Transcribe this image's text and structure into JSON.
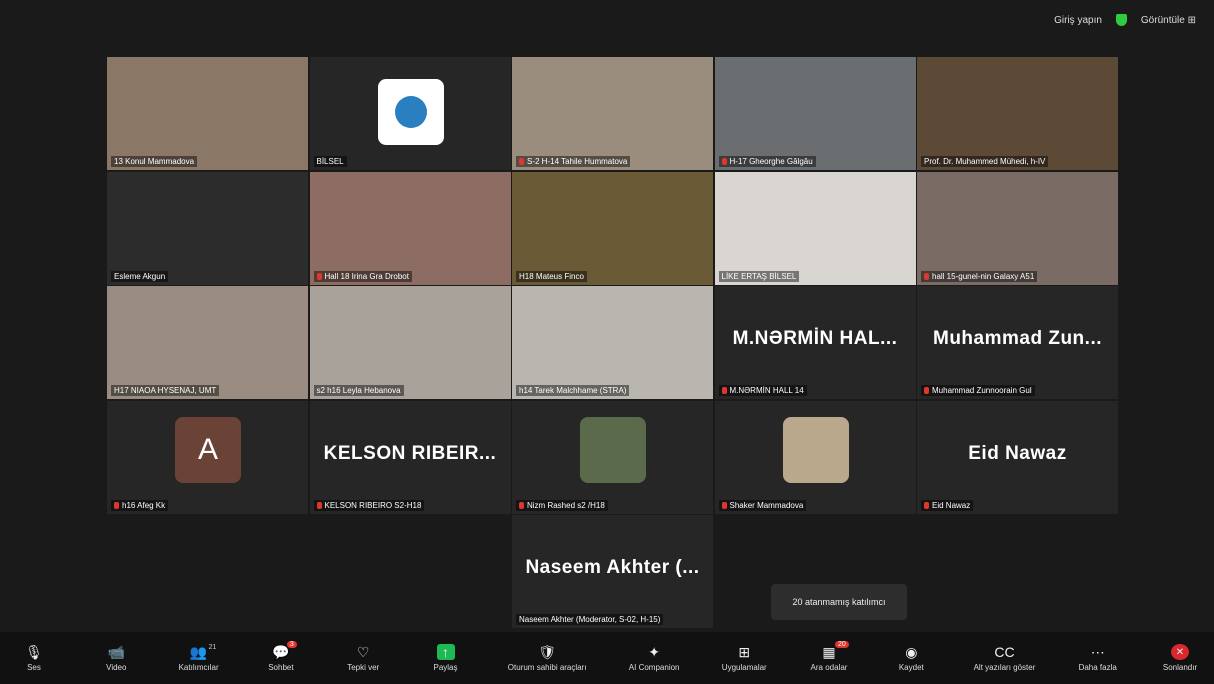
{
  "topbar": {
    "login": "Giriş yapın",
    "view": "Görüntüle"
  },
  "participants": [
    {
      "label": "13 Konul Mammadova",
      "muted": false,
      "bg": "#8a7766"
    },
    {
      "label": "BİLSEL",
      "muted": false,
      "bg": "#262626",
      "logo": true
    },
    {
      "label": "S-2 H-14 Tahile Hummatova",
      "muted": true,
      "bg": "#9a8d7d"
    },
    {
      "label": "H-17 Gheorghe Gâlgâu",
      "muted": true,
      "bg": "#6a6e70"
    },
    {
      "label": "Prof. Dr. Muhammed Mühedi, h-IV",
      "muted": false,
      "bg": "#5c4a36"
    },
    {
      "label": "Esleme Akgun",
      "muted": false,
      "bg": "#2c2c2c"
    },
    {
      "label": "Hall 18 Irina Gra Drobot",
      "muted": true,
      "bg": "#8c6c63"
    },
    {
      "label": "H18 Mateus Finco",
      "muted": false,
      "bg": "#6a5a35"
    },
    {
      "label": "LİKE ERTAŞ BİLSEL",
      "muted": false,
      "bg": "#d9d6d2",
      "active": true
    },
    {
      "label": "hall 15-gunel-nin Galaxy A51",
      "muted": true,
      "bg": "#7a6c64"
    },
    {
      "label": "H17 NIAOA HYSENAJ, UMT",
      "muted": false,
      "bg": "#9a8c80"
    },
    {
      "label": "s2 h16 Leyla Hebanova",
      "muted": false,
      "bg": "#a8a29a"
    },
    {
      "label": "h14 Tarek Malchhame (STRA)",
      "muted": false,
      "bg": "#b8b6ae"
    },
    {
      "label": "M.NƏRMİN HALL 14",
      "muted": true,
      "bg": "#262626",
      "big": "M.NƏRMİN HAL..."
    },
    {
      "label": "Muhammad Zunnoorain Gul",
      "muted": true,
      "bg": "#262626",
      "big": "Muhammad Zun..."
    },
    {
      "label": "h16 Afeg Kk",
      "muted": true,
      "bg": "#262626",
      "letter": "A"
    },
    {
      "label": "KELSON RIBEIRO S2-H18",
      "muted": true,
      "bg": "#262626",
      "big": "KELSON RIBEIR..."
    },
    {
      "label": "Nizm Rashed s2 /H18",
      "muted": true,
      "bg": "#262626",
      "image": "#5a6a4a"
    },
    {
      "label": "Shaker Mammadova",
      "muted": true,
      "bg": "#262626",
      "image": "#b9a88c"
    },
    {
      "label": "Eid Nawaz",
      "muted": true,
      "bg": "#262626",
      "big": "Eid Nawaz"
    },
    {
      "label": "Naseem Akhter (Moderator, S-02, H-15)",
      "muted": false,
      "bg": "#262626",
      "big": "Naseem Akhter (..."
    }
  ],
  "tooltip": "20 atanmamış katılımcı",
  "toolbar": [
    {
      "key": "audio",
      "label": "Ses",
      "icon": "🎙"
    },
    {
      "key": "video",
      "label": "Video",
      "icon": "📹"
    },
    {
      "key": "participants",
      "label": "Katılımcılar",
      "icon": "👥",
      "count": "21"
    },
    {
      "key": "chat",
      "label": "Sohbet",
      "icon": "💬",
      "badge": "3"
    },
    {
      "key": "reactions",
      "label": "Tepki ver",
      "icon": "♡"
    },
    {
      "key": "share",
      "label": "Paylaş",
      "icon": "↑"
    },
    {
      "key": "host",
      "label": "Oturum sahibi araçları",
      "icon": "🛡"
    },
    {
      "key": "ai",
      "label": "AI Companion",
      "icon": "✦"
    },
    {
      "key": "apps",
      "label": "Uygulamalar",
      "icon": "⊞"
    },
    {
      "key": "breakout",
      "label": "Ara odalar",
      "icon": "▦",
      "badge": "20"
    },
    {
      "key": "record",
      "label": "Kaydet",
      "icon": "◉"
    },
    {
      "key": "captions",
      "label": "Alt yazıları göster",
      "icon": "CC"
    },
    {
      "key": "more",
      "label": "Daha fazla",
      "icon": "⋯"
    },
    {
      "key": "end",
      "label": "Sonlandır",
      "icon": "✕"
    }
  ]
}
